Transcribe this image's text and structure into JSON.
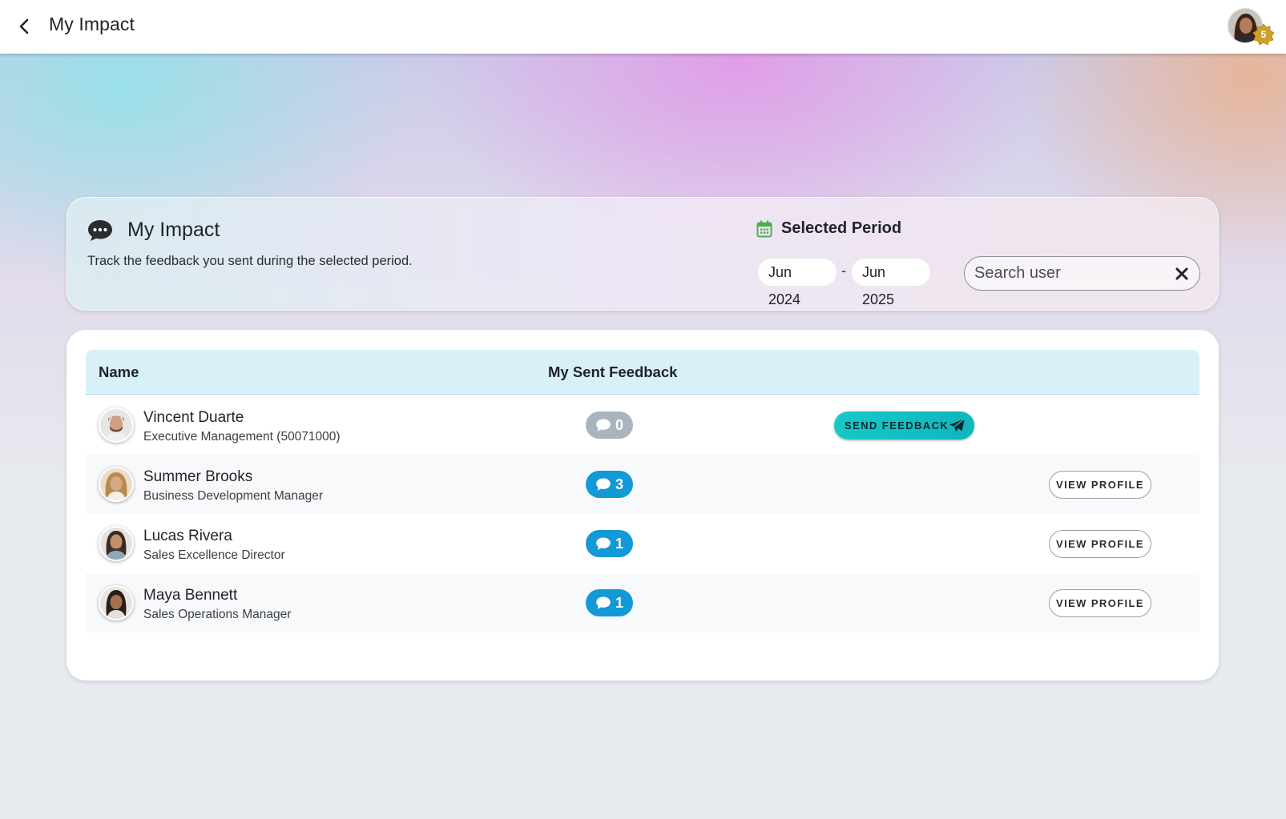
{
  "topbar": {
    "title": "My Impact",
    "back_icon": "chevron-left-icon",
    "user_level": "5"
  },
  "header": {
    "title": "My Impact",
    "icon": "chat-bubble-icon",
    "description": "Track the feedback you sent during the selected period.",
    "period_label": "Selected Period",
    "period_icon": "calendar-icon",
    "period_start": "Jun 2024",
    "period_separator": "-",
    "period_end": "Jun 2025",
    "search": {
      "placeholder": "Search user",
      "value": ""
    }
  },
  "table": {
    "columns": [
      "Name",
      "My Sent Feedback"
    ],
    "rows": [
      {
        "name": "Vincent Duarte",
        "subtitle": "Executive Management (50071000)",
        "sent_feedback": "0",
        "action": "SEND FEEDBACK"
      },
      {
        "name": "Summer Brooks",
        "subtitle": "Business Development Manager",
        "sent_feedback": "3",
        "action": "VIEW PROFILE"
      },
      {
        "name": "Lucas Rivera",
        "subtitle": "Sales Excellence Director",
        "sent_feedback": "1",
        "action": "VIEW PROFILE"
      },
      {
        "name": "Maya Bennett",
        "subtitle": "Sales Operations Manager",
        "sent_feedback": "1",
        "action": "VIEW PROFILE"
      }
    ]
  },
  "colors": {
    "accent_blue": "#1299d6",
    "accent_teal": "#16c8c8",
    "zero_grey": "#a9b4bf",
    "header_row": "#d8f0f7",
    "badge_gold": "#c9a227"
  }
}
